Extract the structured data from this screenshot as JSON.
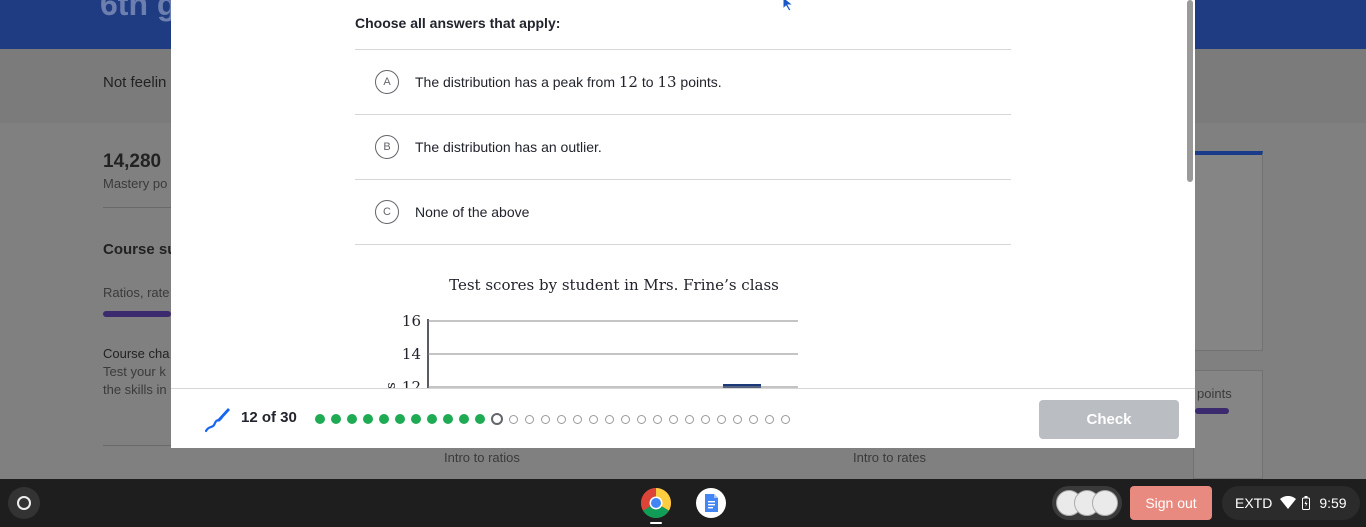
{
  "background": {
    "header_title": "6th g",
    "notice": "Not feelin",
    "mastery_points": "14,280",
    "mastery_label": "Mastery po",
    "course_summary": "Course su",
    "unit_label": "Ratios, rate",
    "challenge_title": "Course cha",
    "challenge_line1": "Test your k",
    "challenge_line2": "the skills in",
    "points_label": "points",
    "link_intro_ratios": "Intro to ratios",
    "link_intro_rates": "Intro to rates"
  },
  "question": {
    "instructions": "Choose all answers that apply:",
    "choices": [
      {
        "letter": "A",
        "pre": "The distribution has a peak from ",
        "n1": "12",
        "mid": " to ",
        "n2": "13",
        "post": " points."
      },
      {
        "letter": "B",
        "text": "The distribution has an outlier."
      },
      {
        "letter": "C",
        "text": "None of the above"
      }
    ]
  },
  "chart_data": {
    "type": "bar",
    "title": "Test scores by student in Mrs. Frine’s class",
    "ylabel": "s",
    "yticks": [
      16,
      14,
      12
    ],
    "ylim_visible": [
      12,
      16
    ],
    "grid": true
  },
  "footer": {
    "progress_label": "12 of 30",
    "completed": 11,
    "current_index": 12,
    "total": 30,
    "check_label": "Check",
    "done_color": "#1fab54"
  },
  "taskbar": {
    "signout_label": "Sign out",
    "tray_label": "EXTD",
    "clock": "9:59"
  }
}
